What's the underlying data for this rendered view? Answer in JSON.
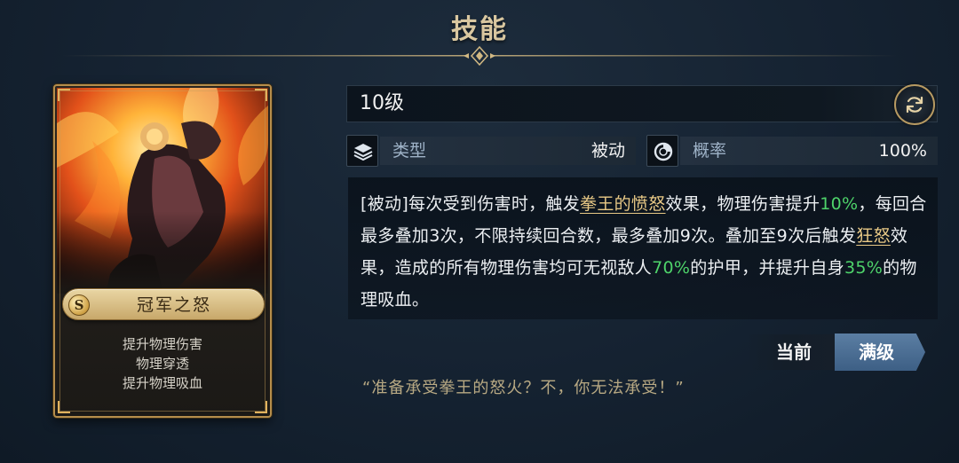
{
  "header": {
    "title": "技能"
  },
  "card": {
    "grade": "S",
    "skill_name": "冠军之怒",
    "effects": [
      "提升物理伤害",
      "物理穿透",
      "提升物理吸血"
    ]
  },
  "level": {
    "label": "10级",
    "refresh_icon": "refresh-icon"
  },
  "stats": {
    "type": {
      "label": "类型",
      "value": "被动",
      "icon": "layers-icon"
    },
    "chance": {
      "label": "概率",
      "value": "100%",
      "icon": "pie-chart-icon"
    }
  },
  "description": {
    "p1": "[被动]每次受到伤害时，触发",
    "link1": "拳王的愤怒",
    "p2": "效果，物理伤害提升",
    "v1": "10%",
    "p3": "，每回合最多叠加3次，不限持续回合数，最多叠加9次。叠加至9次后触发",
    "link2": "狂怒",
    "p4": "效果，造成的所有物理伤害均可无视敌人",
    "v2": "70%",
    "p5": "的护甲，并提升自身",
    "v3": "35%",
    "p6": "的物理吸血。"
  },
  "toggle": {
    "current": "当前",
    "max": "满级",
    "selected": "max"
  },
  "quote": "“准备承受拳王的怒火？不，你无法承受！”",
  "colors": {
    "gold": "#d9c7a0",
    "highlight": "#e9c986",
    "green": "#4ed36a",
    "accent_blue": "#4b6f96"
  }
}
